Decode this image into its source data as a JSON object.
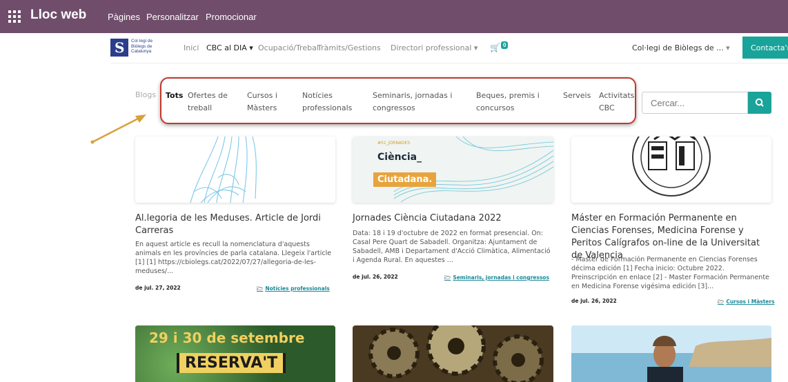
{
  "topbar": {
    "brand": "Lloc web",
    "menu": [
      "Pàgines",
      "Personalitzar",
      "Promocionar"
    ]
  },
  "site": {
    "logo_text": [
      "Col·legi de",
      "Biòlegs de",
      "Catalunya"
    ],
    "nav": [
      "Inici",
      "CBC al DIA",
      "Ocupació/Treball",
      "Tràmits/Gestions",
      "Directori professional"
    ],
    "cart_count": "0",
    "org_menu": "Col·legi de Biòlegs de ...",
    "contact_label": "Contacta'ns"
  },
  "blog": {
    "label": "Blogs",
    "categories": [
      {
        "l1": "Tots",
        "l2": ""
      },
      {
        "l1": "Ofertes de",
        "l2": "treball"
      },
      {
        "l1": "Cursos i",
        "l2": "Màsters"
      },
      {
        "l1": "Notícies",
        "l2": "professionals"
      },
      {
        "l1": "Seminaris, jornadas i",
        "l2": "congressos"
      },
      {
        "l1": "Beques, premis i",
        "l2": "concursos"
      },
      {
        "l1": "Serveis",
        "l2": ""
      },
      {
        "l1": "Activitats",
        "l2": "CBC"
      }
    ],
    "search_placeholder": "Cercar..."
  },
  "posts": [
    {
      "title": "Al.legoria de les Meduses. Article de Jordi Carreras",
      "desc": "En aquest article es recull la nomenclatura d'aquests animals en les províncies de parla catalana. Llegeix l'article [1] [1] https://cbiolegs.cat/2022/07/27/allegoria-de-les-meduses/...",
      "date": "de jul. 27, 2022",
      "category": "Notícies professionals"
    },
    {
      "title": "Jornades Ciència Ciutadana 2022",
      "desc": "Data: 18 i 19 d'octubre de 2022 en format presencial. On: Casal Pere Quart de Sabadell. Organitza: Ajuntament de Sabadell, AMB i Departament d'Acció Climàtica, Alimentació i Agenda Rural. En aquestes ...",
      "date": "de jul. 26, 2022",
      "category": "Seminaris, jornadas i congressos",
      "image_tag": "#01_JORNADES",
      "image_line1": "Ciència_",
      "image_line2": "Ciutadana."
    },
    {
      "title": "Máster en Formación Permanente en Ciencias Forenses, Medicina Forense y Peritos Calígrafos on-line de la Universitat de Valencia",
      "desc": "- Master de Formación Permanente en Ciencias Forenses décima edición [1] Fecha inicio: Octubre 2022. Preinscripción en enlace [2] - Master Formación Permanente en Medicina Forense vigésima edición [3]...",
      "date": "de jul. 26, 2022",
      "category": "Cursos i Màsters"
    }
  ],
  "bottom_posts": {
    "reserve_line1": "29 i 30 de setembre",
    "reserve_line2": "RESERVA'T"
  }
}
